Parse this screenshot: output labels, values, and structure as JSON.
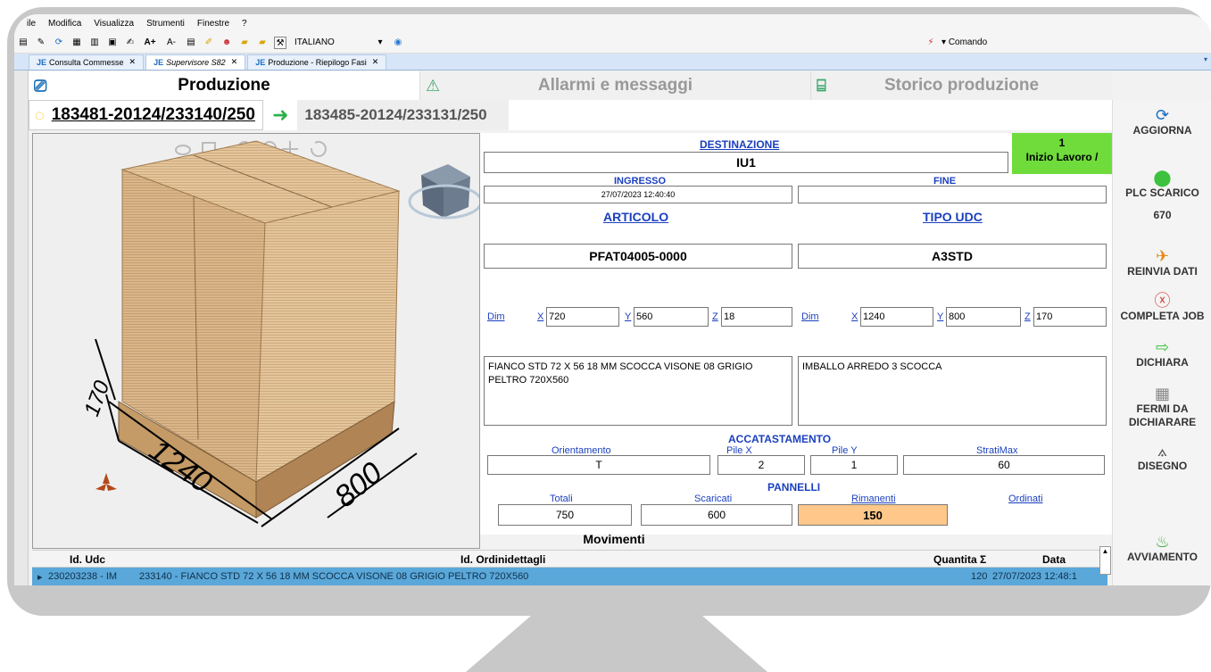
{
  "menu": [
    "ile",
    "Modifica",
    "Visualizza",
    "Strumenti",
    "Finestre",
    "?"
  ],
  "toolbar": {
    "language": "ITALIANO",
    "comando": "Comando",
    "font_up": "A+",
    "font_down": "A-"
  },
  "doc_tabs": [
    {
      "label": "Consulta Commesse"
    },
    {
      "label": "Supervisore S82"
    },
    {
      "label": "Produzione - Riepilogo Fasi"
    }
  ],
  "ribbon_tabs": [
    {
      "label": "Produzione",
      "icon": "monitor-icon"
    },
    {
      "label": "Allarmi e messaggi",
      "icon": "warning-icon"
    },
    {
      "label": "Storico produzione",
      "icon": "history-icon"
    }
  ],
  "orders": {
    "active": "183481-20124/233140/250",
    "next": "183485-20124/233131/250"
  },
  "view3d": {
    "dim_width": "1240",
    "dim_depth": "800",
    "dim_height": "170"
  },
  "form": {
    "destinazione_label": "DESTINAZIONE",
    "destinazione_value": "IU1",
    "status_count": "1",
    "status_text": "Inizio Lavoro /",
    "ingresso_label": "INGRESSO",
    "ingresso_value": "27/07/2023 12:40:40",
    "fine_label": "FINE",
    "fine_value": "",
    "articolo_label": "ARTICOLO",
    "articolo_value": "PFAT04005-0000",
    "tipo_udc_label": "TIPO UDC",
    "tipo_udc_value": "A3STD",
    "dim_label": "Dim",
    "art_dim": {
      "x_label": "X",
      "x": "720",
      "y_label": "Y",
      "y": "560",
      "z_label": "Z",
      "z": "18"
    },
    "udc_dim": {
      "x_label": "X",
      "x": "1240",
      "y_label": "Y",
      "y": "800",
      "z_label": "Z",
      "z": "170"
    },
    "art_desc": "FIANCO STD 72 X 56 18 MM SCOCCA VISONE 08 GRIGIO PELTRO 720X560",
    "udc_desc": "IMBALLO ARREDO 3 SCOCCA",
    "accatastamento_label": "ACCATASTAMENTO",
    "orientamento_label": "Orientamento",
    "orientamento": "T",
    "pile_x_label": "Pile X",
    "pile_x": "2",
    "pile_y_label": "Pile Y",
    "pile_y": "1",
    "stratimax_label": "StratiMax",
    "stratimax": "60",
    "pannelli_label": "PANNELLI",
    "totali_label": "Totali",
    "totali": "750",
    "scaricati_label": "Scaricati",
    "scaricati": "600",
    "rimanenti_label": "Rimanenti",
    "rimanenti": "150",
    "ordinati_label": "Ordinati"
  },
  "side_buttons": {
    "aggiorna": "AGGIORNA",
    "plc_scarico": "PLC SCARICO",
    "plc_value": "670",
    "reinvia": "REINVIA DATI",
    "completa": "COMPLETA JOB",
    "dichiara": "DICHIARA",
    "fermi": "FERMI DA DICHIARARE",
    "disegno": "DISEGNO",
    "avviamento": "AVVIAMENTO"
  },
  "movimenti": {
    "title": "Movimenti",
    "columns": [
      "Id. Udc",
      "Id. Ordinidettagli",
      "Quantita Σ",
      "Data"
    ],
    "rows": [
      {
        "udc": "230203238 - IM",
        "ordine": "233140 - FIANCO STD 72 X 56 18 MM SCOCCA VISONE 08 GRIGIO PELTRO 720X560",
        "qta": "120",
        "data": "27/07/2023 12:48:1"
      }
    ]
  }
}
